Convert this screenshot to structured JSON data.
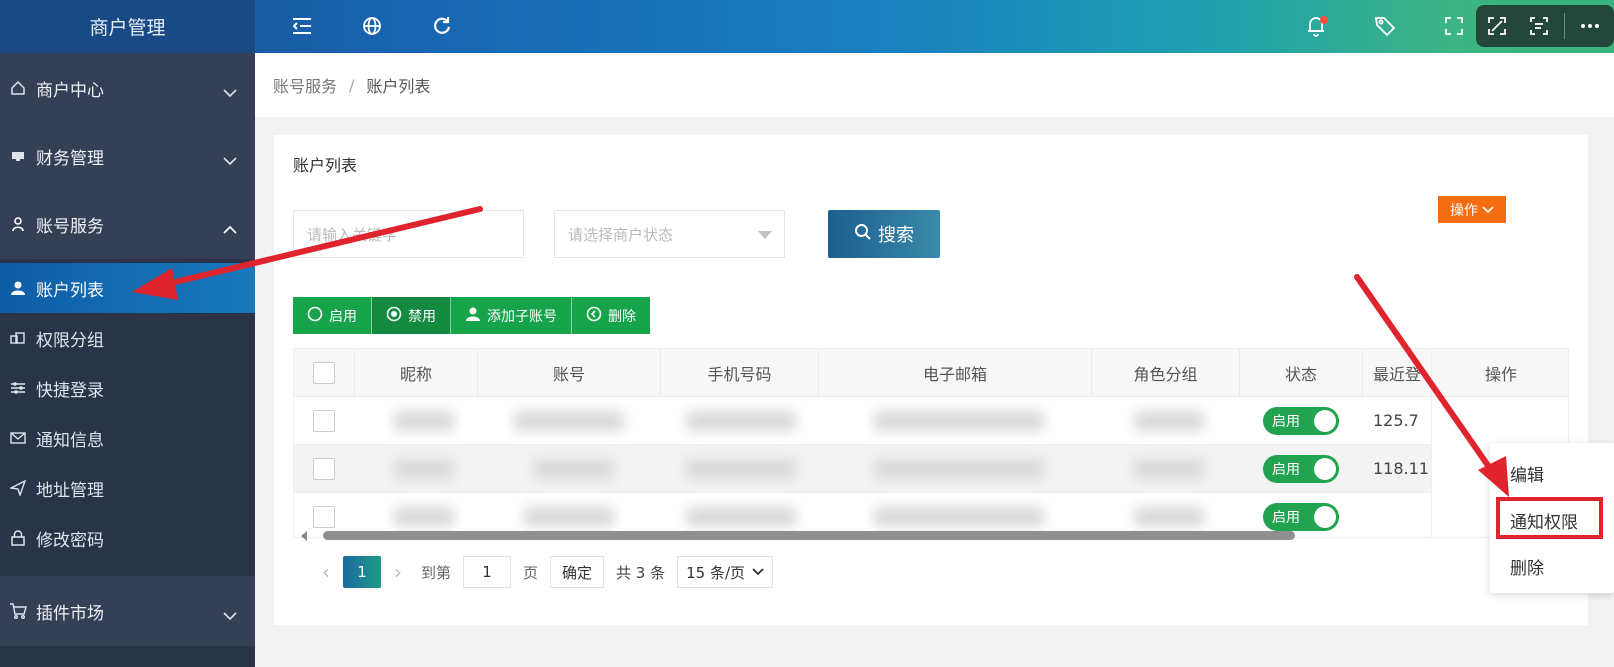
{
  "app": {
    "title": "商户管理"
  },
  "sidebar": {
    "groups": [
      {
        "label": "商户中心",
        "icon": "home-icon"
      },
      {
        "label": "财务管理",
        "icon": "finance-icon"
      },
      {
        "label": "账号服务",
        "icon": "user-icon"
      },
      {
        "label": "插件市场",
        "icon": "cart-icon"
      }
    ],
    "items": [
      {
        "label": "账户列表",
        "icon": "user-solid-icon",
        "active": true
      },
      {
        "label": "权限分组",
        "icon": "group-icon"
      },
      {
        "label": "快捷登录",
        "icon": "sliders-icon"
      },
      {
        "label": "通知信息",
        "icon": "mail-icon"
      },
      {
        "label": "地址管理",
        "icon": "send-icon"
      },
      {
        "label": "修改密码",
        "icon": "lock-icon"
      }
    ]
  },
  "breadcrumb": {
    "parent": "账号服务",
    "separator": "/",
    "current": "账户列表"
  },
  "card": {
    "title": "账户列表"
  },
  "filters": {
    "keyword_placeholder": "请输入关键字",
    "status_placeholder": "请选择商户状态",
    "search_label": "搜索"
  },
  "actions": {
    "enable": "启用",
    "disable": "禁用",
    "add_sub": "添加子账号",
    "delete": "删除"
  },
  "table": {
    "headers": {
      "nickname": "昵称",
      "account": "账号",
      "phone": "手机号码",
      "email": "电子邮箱",
      "role": "角色分组",
      "status": "状态",
      "recent": "最近登",
      "ops": "操作"
    },
    "rows": [
      {
        "status": "启用",
        "ip": "125.7"
      },
      {
        "status": "启用",
        "ip": "118.11"
      },
      {
        "status": "启用",
        "ip": ""
      }
    ],
    "op_button": "操作"
  },
  "pager": {
    "current": "1",
    "goto_label": "到第",
    "page_input": "1",
    "page_unit": "页",
    "confirm": "确定",
    "total": "共 3 条",
    "page_size": "15 条/页"
  },
  "dropdown": {
    "edit": "编辑",
    "notify_perm": "通知权限",
    "delete": "删除"
  },
  "colors": {
    "accent": "#1764b0",
    "green": "#16a34a",
    "orange": "#f56c12",
    "annotation": "#e0242e"
  }
}
